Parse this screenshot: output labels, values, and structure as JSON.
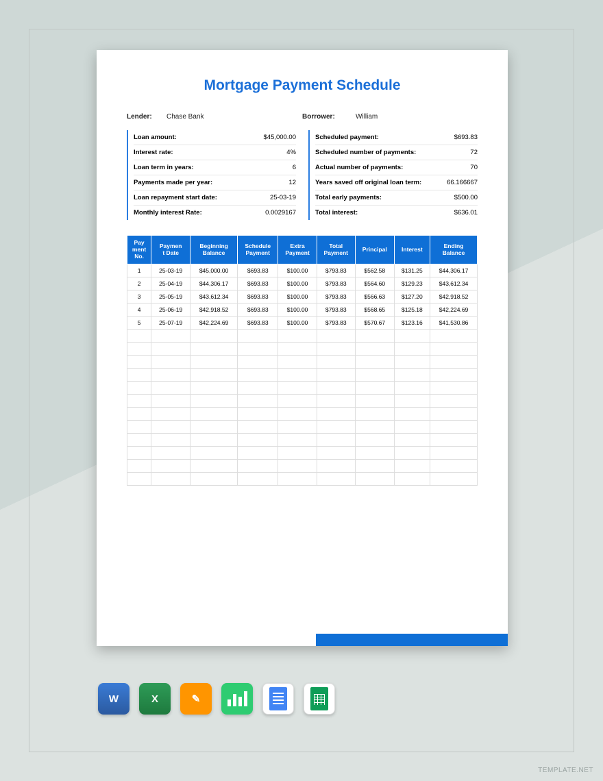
{
  "title": "Mortgage Payment Schedule",
  "lender_label": "Lender:",
  "lender_value": "Chase Bank",
  "borrower_label": "Borrower:",
  "borrower_value": "William",
  "left_summary": [
    {
      "k": "Loan amount:",
      "v": "$45,000.00"
    },
    {
      "k": "Interest rate:",
      "v": "4%"
    },
    {
      "k": "Loan term in years:",
      "v": "6"
    },
    {
      "k": "Payments made per year:",
      "v": "12"
    },
    {
      "k": "Loan repayment start date:",
      "v": "25-03-19"
    },
    {
      "k": "Monthly interest Rate:",
      "v": "0.0029167"
    }
  ],
  "right_summary": [
    {
      "k": "Scheduled payment:",
      "v": "$693.83"
    },
    {
      "k": "Scheduled number of payments:",
      "v": "72"
    },
    {
      "k": "Actual number of payments:",
      "v": "70"
    },
    {
      "k": "Years saved off original loan term:",
      "v": "66.166667"
    },
    {
      "k": "Total early payments:",
      "v": "$500.00"
    },
    {
      "k": "Total interest:",
      "v": "$636.01"
    }
  ],
  "headers": [
    "Pay\nment\nNo.",
    "Paymen\nt Date",
    "Beginning\nBalance",
    "Schedule\nPayment",
    "Extra\nPayment",
    "Total\nPayment",
    "Principal",
    "Interest",
    "Ending\nBalance"
  ],
  "rows": [
    [
      "1",
      "25-03-19",
      "$45,000.00",
      "$693.83",
      "$100.00",
      "$793.83",
      "$562.58",
      "$131.25",
      "$44,306.17"
    ],
    [
      "2",
      "25-04-19",
      "$44,306.17",
      "$693.83",
      "$100.00",
      "$793.83",
      "$564.60",
      "$129.23",
      "$43,612.34"
    ],
    [
      "3",
      "25-05-19",
      "$43,612.34",
      "$693.83",
      "$100.00",
      "$793.83",
      "$566.63",
      "$127.20",
      "$42,918.52"
    ],
    [
      "4",
      "25-06-19",
      "$42,918.52",
      "$693.83",
      "$100.00",
      "$793.83",
      "$568.65",
      "$125.18",
      "$42,224.69"
    ],
    [
      "5",
      "25-07-19",
      "$42,224.69",
      "$693.83",
      "$100.00",
      "$793.83",
      "$570.67",
      "$123.16",
      "$41,530.86"
    ]
  ],
  "empty_rows": 12,
  "icons": {
    "word": "W",
    "excel": "X",
    "pages": "✎"
  },
  "watermark": "TEMPLATE.NET"
}
